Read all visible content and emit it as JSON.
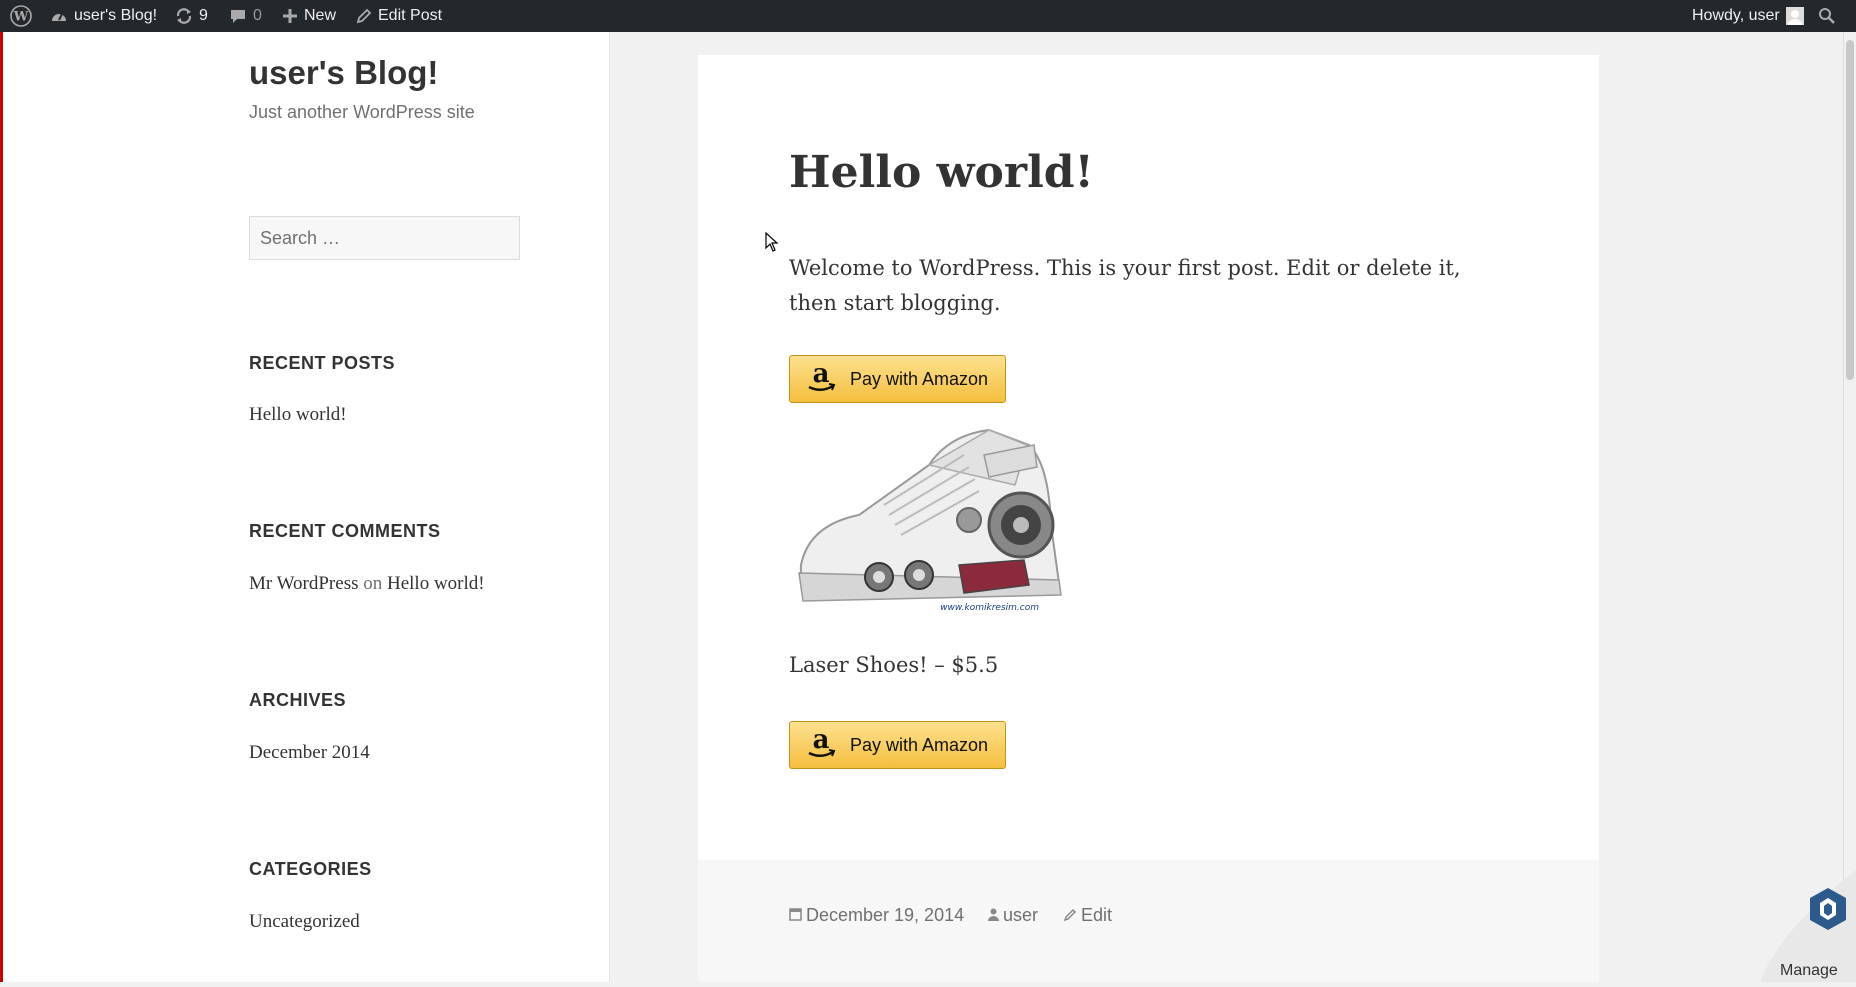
{
  "adminbar": {
    "site_name": "user's Blog!",
    "updates_count": "9",
    "comments_count": "0",
    "new_label": "New",
    "edit_post_label": "Edit Post",
    "howdy": "Howdy, user"
  },
  "sidebar": {
    "site_title": "user's Blog!",
    "site_description": "Just another WordPress site",
    "search_placeholder": "Search …",
    "recent_posts": {
      "title": "RECENT POSTS",
      "items": [
        "Hello world!"
      ]
    },
    "recent_comments": {
      "title": "RECENT COMMENTS",
      "author": "Mr WordPress",
      "on": "on",
      "post": "Hello world!"
    },
    "archives": {
      "title": "ARCHIVES",
      "items": [
        "December 2014"
      ]
    },
    "categories": {
      "title": "CATEGORIES",
      "items": [
        "Uncategorized"
      ]
    }
  },
  "post": {
    "title": "Hello world!",
    "body": "Welcome to WordPress. This is your first post. Edit or delete it, then start blogging.",
    "pay_button_label": "Pay with Amazon",
    "product_line": "Laser Shoes! – $5.5",
    "image_watermark": "www.komikresim.com",
    "footer": {
      "date": "December 19, 2014",
      "author": "user",
      "edit": "Edit"
    }
  },
  "manage_widget": {
    "label": "Manage"
  },
  "colors": {
    "adminbar_bg": "#23282d",
    "amazon_button": "#f4bf3d",
    "accent_left_edge": "#cc0000"
  }
}
